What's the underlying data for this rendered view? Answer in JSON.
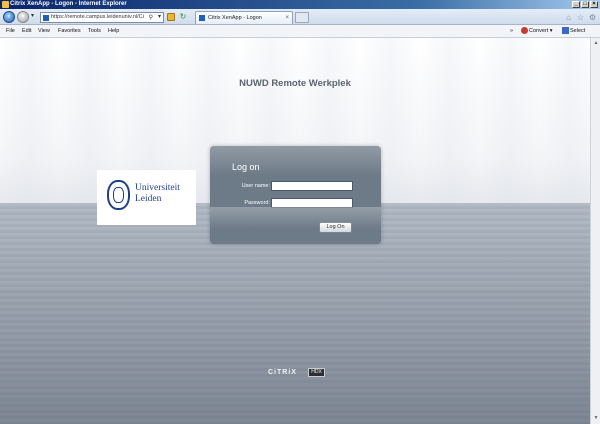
{
  "window": {
    "title": "Citrix XenApp - Logon - Internet Explorer"
  },
  "browser": {
    "address_url": "https://remote.campus.leidenuniv.nl/Ci",
    "tab_label": "Citrix XenApp - Logon",
    "tab_close": "×"
  },
  "menu": {
    "items": [
      "File",
      "Edit",
      "View",
      "Favorites",
      "Tools",
      "Help"
    ]
  },
  "toolbar": {
    "convert_label": "Convert",
    "select_label": "Select"
  },
  "page": {
    "heading": "NUWD Remote Werkplek"
  },
  "logo": {
    "line1": "Universiteit",
    "line2": "Leiden"
  },
  "logon": {
    "title": "Log on",
    "username_label": "User name:",
    "username_value": "",
    "password_label": "Password:",
    "password_value": "",
    "button_label": "Log On"
  },
  "footer": {
    "brand": "CiTRiX",
    "badge": "HDX"
  },
  "colors": {
    "panel": "#6d7a87",
    "title_bar": "#0a246a",
    "university_blue": "#1f3f8c"
  }
}
